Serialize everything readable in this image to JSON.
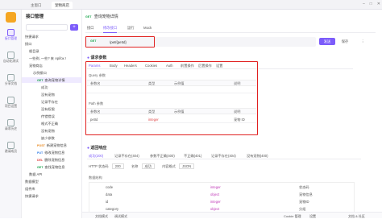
{
  "titlebar": {
    "tabs": [
      "主窗口",
      "宠物商店"
    ],
    "window_controls": [
      "minimize-icon",
      "maximize-icon",
      "close-icon"
    ]
  },
  "rail": {
    "items": [
      {
        "label": "接口管理",
        "icon": "api-icon"
      },
      {
        "label": "自动化测试",
        "icon": "test-icon"
      },
      {
        "label": "分享文档",
        "icon": "doc-icon"
      },
      {
        "label": "项目设置",
        "icon": "settings-icon"
      },
      {
        "label": "请求历史",
        "icon": "history-icon"
      },
      {
        "label": "邀请成员",
        "icon": "invite-icon"
      }
    ]
  },
  "tree": {
    "title": "接口管理",
    "search_placeholder": "",
    "items": [
      {
        "label": "快捷请求",
        "method": "",
        "indent": 0
      },
      {
        "label": "接口",
        "method": "",
        "indent": 0
      },
      {
        "label": "根目录",
        "method": "",
        "indent": 1
      },
      {
        "label": "一些例, 一些? 来 Apifox !",
        "method": "",
        "indent": 1
      },
      {
        "label": "宠物商店",
        "method": "",
        "indent": 1
      },
      {
        "label": "示例接口",
        "method": "",
        "indent": 2
      },
      {
        "label": "查询宠物详情",
        "method": "GET",
        "indent": 3,
        "selected": true
      },
      {
        "label": "成功",
        "method": "",
        "indent": 4
      },
      {
        "label": "没有宠物",
        "method": "",
        "indent": 4
      },
      {
        "label": "记录不存在",
        "method": "",
        "indent": 4
      },
      {
        "label": "没有权限",
        "method": "",
        "indent": 4
      },
      {
        "label": "传错错误",
        "method": "",
        "indent": 4
      },
      {
        "label": "格式不正确",
        "method": "",
        "indent": 4
      },
      {
        "label": "没有宠物",
        "method": "",
        "indent": 4
      },
      {
        "label": "缺少参数",
        "method": "",
        "indent": 4
      },
      {
        "label": "新建宠物信息",
        "method": "POST",
        "indent": 3
      },
      {
        "label": "修改宠物信息",
        "method": "PUT",
        "indent": 3
      },
      {
        "label": "删除宠物信息",
        "method": "DEL",
        "indent": 3
      },
      {
        "label": "查找宠物信息",
        "method": "GET",
        "indent": 3
      },
      {
        "label": "数据 API",
        "method": "",
        "indent": 1
      },
      {
        "label": "数据模型",
        "method": "",
        "indent": 0
      },
      {
        "label": "组件库",
        "method": "",
        "indent": 0
      },
      {
        "label": "快捷请求",
        "method": "",
        "indent": 0
      }
    ]
  },
  "main": {
    "header": {
      "method": "GET",
      "title": "查询宠物详情"
    },
    "tabs": [
      "接口",
      "修改接口",
      "运行",
      "Mock"
    ],
    "active_tab": "修改接口",
    "url": {
      "method": "GET",
      "path": "/pet/{petId}"
    },
    "send_label": "发送",
    "save_label": "保存",
    "request_section": "请求参数",
    "param_tabs": [
      "Params",
      "Body",
      "Headers",
      "Cookies",
      "Auth",
      "前置操作",
      "后置操作",
      "设置"
    ],
    "query_label": "Query 参数",
    "table_headers": [
      "参数名",
      "类型",
      "示例值",
      "说明"
    ],
    "path_label": "Path 参数",
    "path_row": {
      "name": "petId",
      "type": "integer",
      "example": "",
      "desc": "宠物 ID"
    },
    "response_section": "返回响应",
    "response_tabs": [
      "成功(200)",
      "记录不存在(404)",
      "参数不正确(400)",
      "不正确(401)",
      "记录不存在(404)",
      "没有宠物(400)"
    ],
    "response_meta": {
      "http_status_label": "HTTP 状态码",
      "http_status": "200",
      "name_label": "名称",
      "name": "成功",
      "content_type_label": "内容格式",
      "content_type": "JSON"
    },
    "schema_label": "数据结构",
    "schema_rows": [
      {
        "name": "code",
        "type": "integer",
        "desc": "状态码"
      },
      {
        "name": "data",
        "type": "object",
        "desc": "宠物信息"
      },
      {
        "name": "id",
        "type": "integer",
        "desc": "宠物ID"
      },
      {
        "name": "category",
        "type": "object",
        "desc": "分组"
      }
    ],
    "footer_buttons": [
      "文档模式",
      "调试模式"
    ],
    "footer_right": [
      "Cookie 管理",
      "设置",
      "文档 & 社区"
    ]
  },
  "accent": "#7c5cfa"
}
